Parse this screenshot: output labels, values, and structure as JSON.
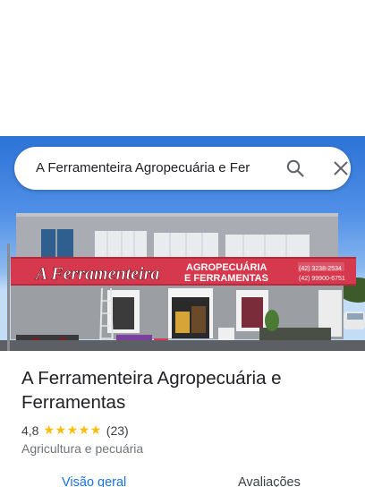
{
  "search": {
    "query": "A Ferramenteira Agropecuária e Fer"
  },
  "photo": {
    "sign_name": "A Ferramenteira",
    "sign_line1": "AGROPECUÁRIA",
    "sign_line2": "E FERRAMENTAS",
    "phone1": "(42) 3238-2534",
    "phone2": "(42) 99900-6751"
  },
  "place": {
    "title": "A Ferramenteira Agropecuária e Ferramentas",
    "rating": "4,8",
    "stars": 5,
    "review_count": "(23)",
    "category": "Agricultura e pecuária"
  },
  "tabs": [
    {
      "label": "Visão geral",
      "active": true
    },
    {
      "label": "Avaliações",
      "active": false
    }
  ],
  "colors": {
    "accent": "#1a73e8",
    "star": "#fbbc04",
    "sign": "#d6384d"
  }
}
